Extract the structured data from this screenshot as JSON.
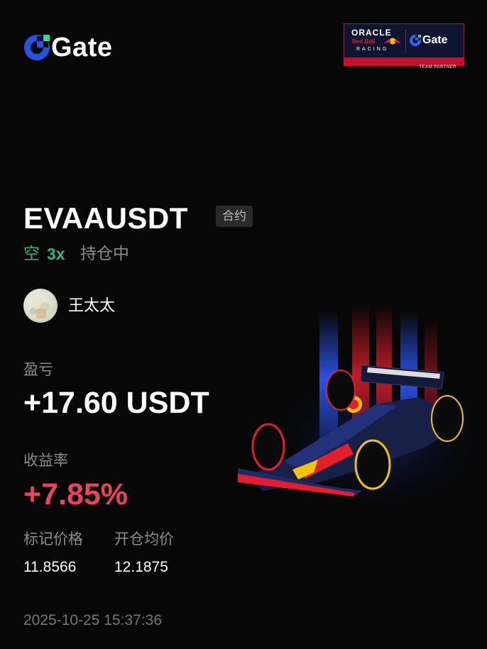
{
  "brand": {
    "name": "Gate"
  },
  "partner_badge": {
    "oracle": "ORACLE",
    "redbull": "Red Bull",
    "racing": "RACING",
    "gate": "Gate",
    "caption": "TEAM PARTNER"
  },
  "position": {
    "symbol": "EVAAUSDT",
    "tag": "合约",
    "side": "空",
    "leverage": "3x",
    "status": "持仓中"
  },
  "user": {
    "name": "王太太"
  },
  "pnl": {
    "label": "盈亏",
    "value": "+17.60 USDT"
  },
  "roi": {
    "label": "收益率",
    "value": "+7.85%"
  },
  "prices": {
    "mark_label": "标记价格",
    "mark_value": "11.8566",
    "entry_label": "开仓均价",
    "entry_value": "12.1875"
  },
  "timestamp": "2025-10-25 15:37:36",
  "colors": {
    "background": "#070707",
    "short": "#2fb87a",
    "profit_rate": "#e8445c",
    "muted": "#8c8c8c",
    "brand_blue": "#2354e6",
    "brand_green": "#17e6a1"
  },
  "icons": {
    "logo": "gate-logo-icon",
    "car": "f1-car-illustration"
  }
}
